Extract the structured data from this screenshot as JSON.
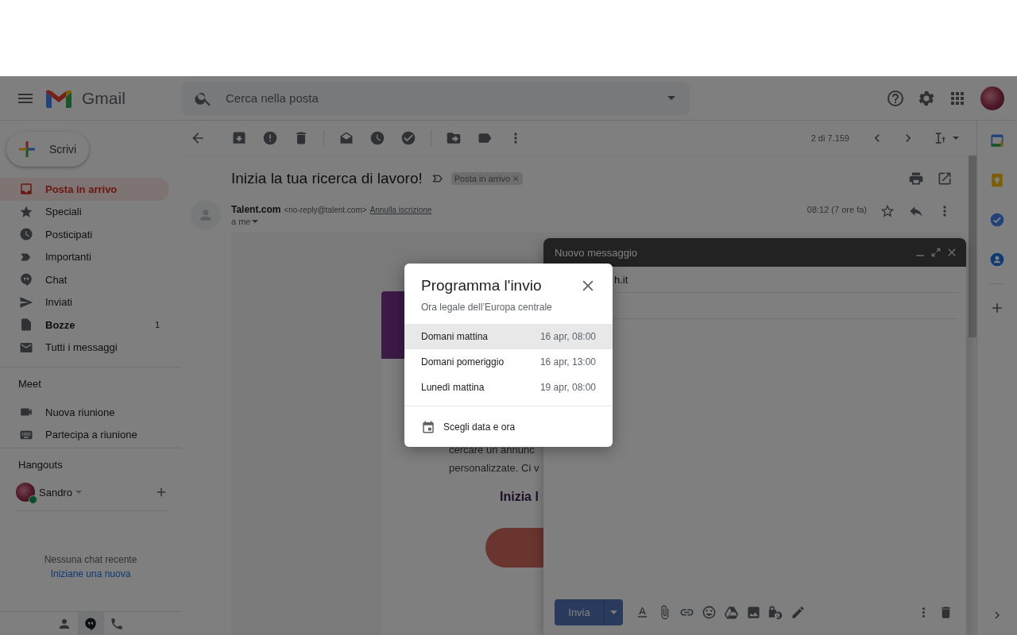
{
  "header": {
    "app_name": "Gmail",
    "search": {
      "placeholder": "Cerca nella posta"
    }
  },
  "compose_button": {
    "label": "Scrivi"
  },
  "nav": [
    {
      "kind": "inbox",
      "label": "Posta in arrivo",
      "selected": true,
      "unread": false
    },
    {
      "kind": "starred",
      "label": "Speciali",
      "selected": false,
      "unread": false
    },
    {
      "kind": "snoozed",
      "label": "Posticipati",
      "selected": false,
      "unread": false
    },
    {
      "kind": "important",
      "label": "Importanti",
      "selected": false,
      "unread": false
    },
    {
      "kind": "chat",
      "label": "Chat",
      "selected": false,
      "unread": false
    },
    {
      "kind": "sent",
      "label": "Inviati",
      "selected": false,
      "unread": false
    },
    {
      "kind": "drafts",
      "label": "Bozze",
      "count": "1",
      "selected": false,
      "unread": true
    },
    {
      "kind": "all",
      "label": "Tutti i messaggi",
      "selected": false,
      "unread": false
    }
  ],
  "meet": {
    "heading": "Meet",
    "items": [
      {
        "kind": "video",
        "label": "Nuova riunione"
      },
      {
        "kind": "keyboard",
        "label": "Partecipa a riunione"
      }
    ]
  },
  "hangouts": {
    "heading": "Hangouts",
    "user": {
      "name": "Sandro",
      "online": true
    },
    "empty_text": "Nessuna chat recente",
    "start_link": "Iniziane una nuova",
    "tabs": [
      {
        "kind": "contacts",
        "selected": false
      },
      {
        "kind": "chat",
        "selected": true
      },
      {
        "kind": "phone",
        "selected": false
      }
    ]
  },
  "toolbar": {
    "pagination": "2 di 7.159"
  },
  "message": {
    "subject": "Inizia la tua ricerca di lavoro!",
    "label_chip": "Posta in arrivo",
    "sender_name": "Talent.com",
    "sender_email": "<no-reply@talent.com>",
    "unsubscribe": "Annulla iscrizione",
    "recipient": "a me",
    "time": "08:12 (7 ore fa)",
    "starred": false,
    "body_lines": [
      "cercare un annunc",
      "personalizzate. Ci v"
    ],
    "body_heading": "Inizia l"
  },
  "compose": {
    "title": "Nuovo messaggio",
    "to_value": "h.it",
    "send_label": "Invia"
  },
  "schedule_dialog": {
    "title": "Programma l'invio",
    "subtitle": "Ora legale dell’Europa centrale",
    "options": [
      {
        "label": "Domani mattina",
        "time": "16 apr, 08:00",
        "selected": true
      },
      {
        "label": "Domani pomeriggio",
        "time": "16 apr, 13:00",
        "selected": false
      },
      {
        "label": "Lunedì mattina",
        "time": "19 apr, 08:00",
        "selected": false
      }
    ],
    "custom_label": "Scegli data e ora"
  }
}
